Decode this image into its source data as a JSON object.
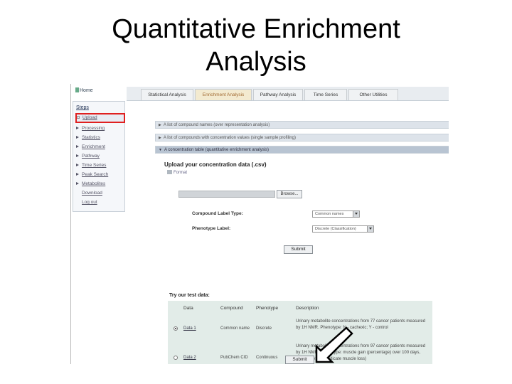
{
  "slide": {
    "title_line1": "Quantitative Enrichment",
    "title_line2": "Analysis"
  },
  "app": {
    "logo_text": "Home",
    "steps_title": "Steps",
    "steps": [
      {
        "label": "Upload",
        "icon": "square-icon",
        "active": true
      },
      {
        "label": "Processing",
        "icon": "triangle-icon"
      },
      {
        "label": "Statistics",
        "icon": "triangle-icon"
      },
      {
        "label": "Enrichment",
        "icon": "triangle-icon"
      },
      {
        "label": "Pathway",
        "icon": "triangle-icon"
      },
      {
        "label": "Time Series",
        "icon": "triangle-icon"
      },
      {
        "label": "Peak Search",
        "icon": "triangle-icon"
      },
      {
        "label": "Metabolites",
        "icon": "triangle-icon"
      },
      {
        "label": "Download",
        "icon": "none"
      },
      {
        "label": "Log out",
        "icon": "none"
      }
    ],
    "tabs": [
      {
        "label": "Statistical Analysis"
      },
      {
        "label": "Enrichment Analysis",
        "active": true
      },
      {
        "label": "Pathway Analysis"
      },
      {
        "label": "Time Series"
      },
      {
        "label": "Other Utilities"
      }
    ],
    "accordion": [
      {
        "label": "A list of compound names (over representation analysis)"
      },
      {
        "label": "A list of compounds with concentration values (single sample profiling)"
      },
      {
        "label": "A concentration table (quantitative enrichment analysis)",
        "open": true
      }
    ],
    "upload": {
      "title": "Upload your concentration data (.csv)",
      "format_link": "Format",
      "browse_label": "Browse...",
      "compound_label_type": "Compound Label Type:",
      "compound_label_value": "Common names",
      "phenotype_label": "Phenotype Label:",
      "phenotype_value": "Discrete (Classification)",
      "submit_label": "Submit"
    },
    "test_data": {
      "title": "Try our test data:",
      "headers": [
        "Data",
        "Compound",
        "Phenotype",
        "Description"
      ],
      "rows": [
        {
          "data": "Data 1",
          "compound": "Common name",
          "phenotype": "Discrete",
          "selected": true,
          "description": "Urinary metabolite concentrations from 77 cancer patients measured by 1H NMR. Phenotype: N - cachexic; Y - control"
        },
        {
          "data": "Data 2",
          "compound": "PubChem CID",
          "phenotype": "Continuous",
          "selected": false,
          "description": "Urinary metabolite concentrations from 97 cancer patients measured by 1H NMR. Phenotype: muscle gain (percentage) over 100 days, negative values indicate muscle loss)"
        }
      ],
      "submit_label": "Submit"
    }
  }
}
